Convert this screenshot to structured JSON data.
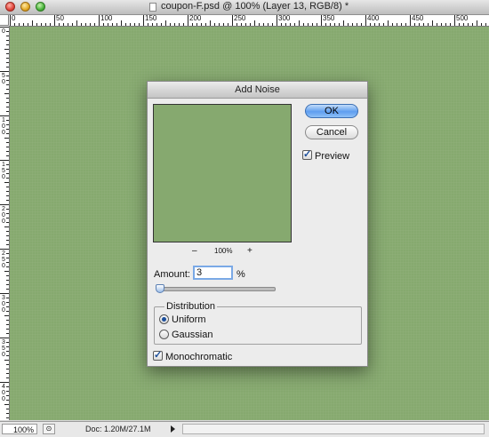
{
  "window": {
    "title": "coupon-F.psd @ 100% (Layer 13, RGB/8) *"
  },
  "ruler": {
    "h_labels": [
      "0",
      "50",
      "100",
      "150",
      "200",
      "250",
      "300",
      "350",
      "400",
      "450",
      "500"
    ],
    "v_labels": [
      "0",
      "50",
      "100",
      "150",
      "200",
      "250",
      "300",
      "350",
      "400"
    ]
  },
  "status": {
    "zoom": "100%",
    "doc": "Doc: 1.20M/27.1M"
  },
  "dialog": {
    "title": "Add Noise",
    "ok_label": "OK",
    "cancel_label": "Cancel",
    "preview_label": "Preview",
    "preview_checked": true,
    "zoom_minus": "–",
    "zoom_percent": "100%",
    "zoom_plus": "+",
    "amount_label": "Amount:",
    "amount_value": "3",
    "amount_unit": "%",
    "amount_slider_value": 3,
    "distribution_label": "Distribution",
    "uniform_label": "Uniform",
    "gaussian_label": "Gaussian",
    "distribution_selected": "Uniform",
    "monochromatic_label": "Monochromatic",
    "monochromatic_checked": true
  },
  "colors": {
    "canvas": "#86a96f",
    "accent": "#5f9ef0"
  }
}
